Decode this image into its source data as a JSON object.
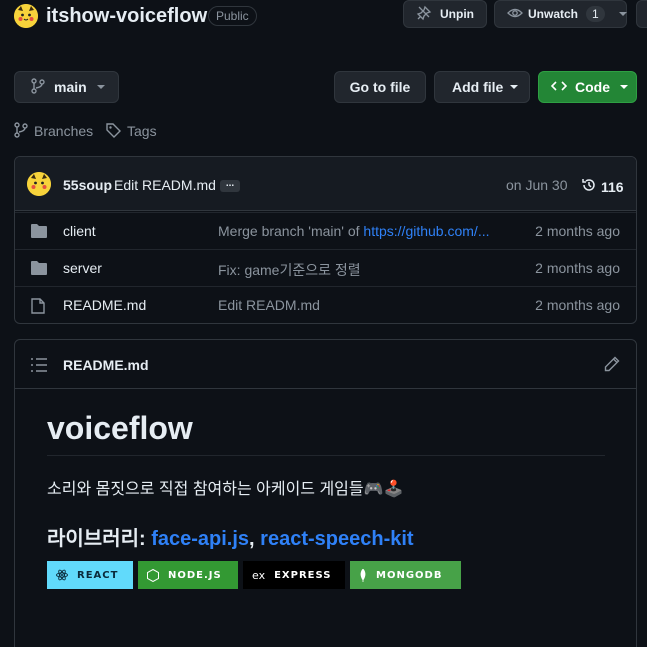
{
  "repo": {
    "name": "itshow-voiceflow",
    "visibility": "Public",
    "unpin_label": "Unpin",
    "unwatch_label": "Unwatch",
    "watch_count": "1"
  },
  "toolbar": {
    "branch": "main",
    "goto_file": "Go to file",
    "add_file": "Add file",
    "code": "Code",
    "branches": "Branches",
    "tags": "Tags"
  },
  "commit": {
    "author": "55soup",
    "message": "Edit READM.md",
    "ellipsis": "...",
    "date": "on Jun 30",
    "count": "116"
  },
  "files": [
    {
      "name": "client",
      "type": "folder",
      "msg_prefix": "Merge branch 'main' of ",
      "msg_link": "https://github.com/...",
      "date": "2 months ago"
    },
    {
      "name": "server",
      "type": "folder",
      "msg_prefix": "Fix: game기준으로 정렬",
      "msg_link": "",
      "date": "2 months ago"
    },
    {
      "name": "README.md",
      "type": "file",
      "msg_prefix": "Edit READM.md",
      "msg_link": "",
      "date": "2 months ago"
    }
  ],
  "readme": {
    "header": "README.md",
    "h1": "voiceflow",
    "description": "소리와 몸짓으로 직접 참여하는 아케이드 게임들🎮🕹️",
    "h2_prefix": "라이브러리: ",
    "h2_link1": "face-api.js",
    "h2_sep": ", ",
    "h2_link2": "react-speech-kit",
    "badges": [
      {
        "label": "REACT",
        "bg": "#61dafb",
        "fg": "#0a2a3a",
        "icon": "react-icon"
      },
      {
        "label": "NODE.JS",
        "bg": "#339933",
        "fg": "#ffffff",
        "icon": "nodejs-icon"
      },
      {
        "label": "EXPRESS",
        "bg": "#000000",
        "fg": "#ffffff",
        "icon": "express-icon"
      },
      {
        "label": "MONGODB",
        "bg": "#47a248",
        "fg": "#ffffff",
        "icon": "mongodb-icon"
      }
    ]
  },
  "colors": {
    "bg": "#0d1117",
    "accent_green": "#238636",
    "link": "#2f81f7",
    "muted": "#8b949e"
  }
}
